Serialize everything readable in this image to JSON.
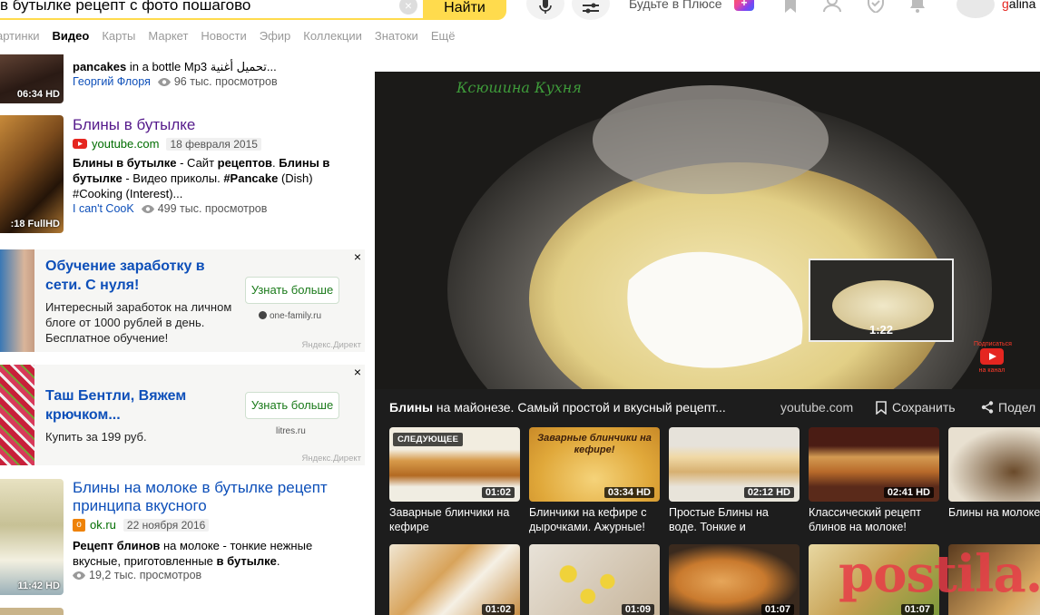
{
  "search": {
    "query": "в бутылке рецепт с фото пошагово",
    "find_label": "Найти"
  },
  "header": {
    "plus_link": "Будьте в Плюсе",
    "plus_badge": "+",
    "username_first": "g",
    "username_rest": "alina"
  },
  "tabs": [
    {
      "label": "артинки",
      "active": false
    },
    {
      "label": "Видео",
      "active": true
    },
    {
      "label": "Карты",
      "active": false
    },
    {
      "label": "Маркет",
      "active": false
    },
    {
      "label": "Новости",
      "active": false
    },
    {
      "label": "Эфир",
      "active": false
    },
    {
      "label": "Коллекции",
      "active": false
    },
    {
      "label": "Знатоки",
      "active": false
    },
    {
      "label": "Ещё",
      "active": false
    }
  ],
  "results": {
    "r0": {
      "duration": "06:34",
      "quality": "HD",
      "snippet_bold": "pancakes",
      "snippet_rest": " in a bottle Mp3 تحميل أغنية...",
      "author": "Георгий Флоря",
      "views": "96 тыс. просмотров"
    },
    "r1": {
      "duration": ":18",
      "quality": "FullHD",
      "title": "Блины в бутылке",
      "source": "youtube.com",
      "date": "18 февраля 2015",
      "snippet_1b": "Блины в бутылке",
      "snippet_1": " - Сайт ",
      "snippet_1c": "рецептов",
      "snippet_1d": ". ",
      "snippet_1e": "Блины в бутылке",
      "snippet_1f": " - Видео приколы. ",
      "snippet_1g": "#Pancake",
      "snippet_1h": " (Dish) #Cooking (Interest)...",
      "author": "I can't CooK",
      "views": "499 тыс. просмотров"
    },
    "ad1": {
      "title": "Обучение заработку в сети. С нуля!",
      "text": "Интересный заработок на личном блоге от 1000 рублей в день. Бесплатное обучение!",
      "button": "Узнать больше",
      "site": "one-family.ru",
      "direct": "Яндекс.Директ",
      "close": "×"
    },
    "ad2": {
      "title": "Таш Бентли, Вяжем крючком...",
      "text": "Купить за 199 руб.",
      "button": "Узнать больше",
      "site": "litres.ru",
      "direct": "Яндекс.Директ",
      "close": "×"
    },
    "r2": {
      "duration": "11:42",
      "quality": "HD",
      "title_b1": "Блины",
      "title_1": " на молоке ",
      "title_b2": "в бутылке",
      "title_b3": "рецепт",
      "title_2": " принципа вкусного",
      "source": "ok.ru",
      "date": "22 ноября 2016",
      "snip_b1": "Рецепт блинов",
      "snip_1": " на молоке - тонкие нежные вкусные, приготовленные ",
      "snip_b2": "в бутылке",
      "snip_2": ".",
      "views": "19,2 тыс. просмотров"
    }
  },
  "player": {
    "overlay_text": "Ксюшина Кухня",
    "mini_time": "1:22",
    "subscribe_line1": "Подписаться",
    "subscribe_line2": "на канал",
    "title_bold": "Блины",
    "title_rest": " на майонезе. Самый простой и вкусный рецепт...",
    "source": "youtube.com",
    "save_label": "Сохранить",
    "share_label": "Подел"
  },
  "related": [
    {
      "next": "СЛЕДУЮЩЕЕ",
      "duration": "01:02",
      "quality": "",
      "caption": "Заварные блинчики на кефире",
      "img_text": ""
    },
    {
      "next": "",
      "duration": "03:34",
      "quality": "HD",
      "caption": "Блинчики на кефире с дырочками. Ажурные!",
      "img_text": "Заварные блинчики на кефире!"
    },
    {
      "next": "",
      "duration": "02:12",
      "quality": "HD",
      "caption": "Простые Блины на воде. Тонкие и",
      "img_text": ""
    },
    {
      "next": "",
      "duration": "02:41",
      "quality": "HD",
      "caption": "Классический рецепт блинов на молоке!",
      "img_text": ""
    },
    {
      "next": "",
      "duration": "",
      "quality": "",
      "caption": "Блины на молоке",
      "img_text": ""
    },
    {
      "next": "",
      "duration": "01:02",
      "quality": "",
      "caption": "",
      "img_text": ""
    },
    {
      "next": "",
      "duration": "01:09",
      "quality": "",
      "caption": "",
      "img_text": ""
    },
    {
      "next": "",
      "duration": "01:07",
      "quality": "",
      "caption": "",
      "img_text": ""
    },
    {
      "next": "",
      "duration": "01:07",
      "quality": "",
      "caption": "",
      "img_text": ""
    },
    {
      "next": "",
      "duration": "",
      "quality": "",
      "caption": "",
      "img_text": ""
    }
  ],
  "watermark": "postila.ru",
  "colors": {
    "brand_yellow": "#ffdb4d",
    "link_blue": "#0d4fb9",
    "visited_purple": "#551a8b",
    "player_bg": "#1d1d1d"
  }
}
